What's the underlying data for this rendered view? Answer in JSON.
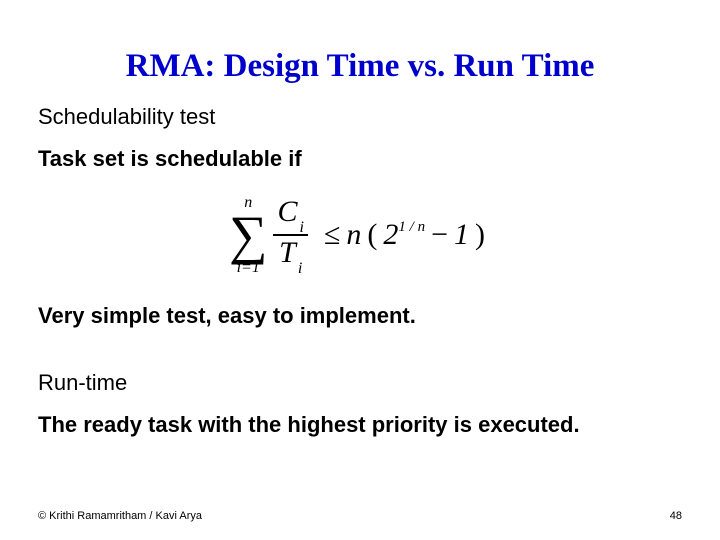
{
  "title": "RMA: Design Time vs. Run Time",
  "line1": "Schedulability test",
  "line2": "Task set is schedulable if",
  "formula": {
    "sum_upper": "n",
    "sum_lower": "i=1",
    "frac_num_base": "C",
    "frac_num_sub": "i",
    "frac_den_base": "T",
    "frac_den_sub": "i",
    "rhs_n1": "n",
    "rhs_base": "2",
    "rhs_exp": "1 / n",
    "rhs_minus": "1"
  },
  "line3": "Very simple test, easy to implement.",
  "line4": "Run-time",
  "line5": "The ready task with the highest priority is executed.",
  "footer_left": "© Krithi Ramamritham / Kavi Arya",
  "footer_right": "48"
}
